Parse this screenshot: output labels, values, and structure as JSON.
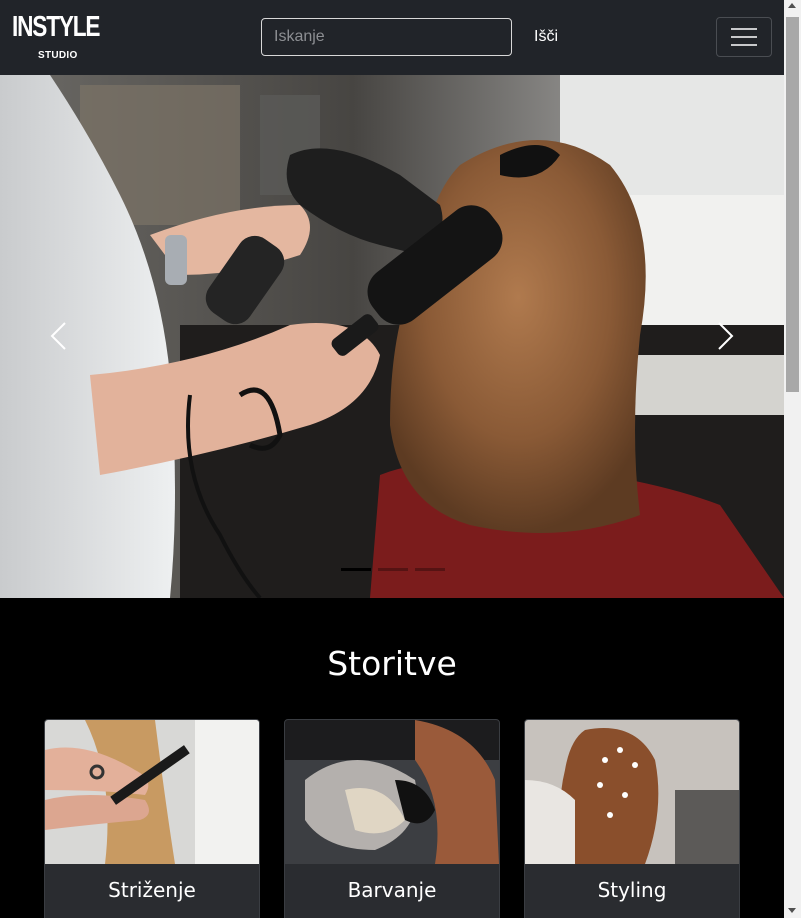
{
  "navbar": {
    "brand_title": "INSTYLE",
    "brand_subtitle": "STUDIO",
    "search_placeholder": "Iskanje",
    "search_value": "",
    "search_button_label": "Išči",
    "menu_icon": "hamburger-icon"
  },
  "carousel": {
    "slide_count": 3,
    "active_slide": 1,
    "prev_icon": "chevron-left-icon",
    "next_icon": "chevron-right-icon"
  },
  "services": {
    "title": "Storitve",
    "cards": [
      {
        "title": "Striženje"
      },
      {
        "title": "Barvanje"
      },
      {
        "title": "Styling"
      }
    ]
  },
  "colors": {
    "navbar_bg": "#212429",
    "page_bg": "#000000",
    "card_bg": "#2a2c30"
  }
}
